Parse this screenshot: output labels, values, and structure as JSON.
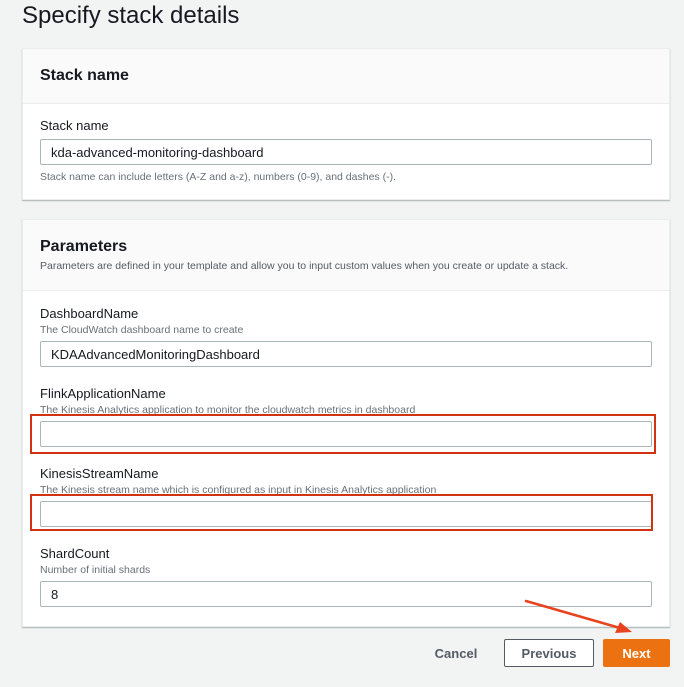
{
  "page": {
    "title": "Specify stack details"
  },
  "stack_name_panel": {
    "title": "Stack name",
    "field_label": "Stack name",
    "field_value": "kda-advanced-monitoring-dashboard",
    "constraint": "Stack name can include letters (A-Z and a-z), numbers (0-9), and dashes (-)."
  },
  "parameters_panel": {
    "title": "Parameters",
    "description": "Parameters are defined in your template and allow you to input custom values when you create or update a stack.",
    "fields": [
      {
        "label": "DashboardName",
        "description": "The CloudWatch dashboard name to create",
        "value": "KDAAdvancedMonitoringDashboard"
      },
      {
        "label": "FlinkApplicationName",
        "description": "The Kinesis Analytics application to monitor the cloudwatch metrics in dashboard",
        "value": ""
      },
      {
        "label": "KinesisStreamName",
        "description": "The Kinesis stream name which is configured as input in Kinesis Analytics application",
        "value": ""
      },
      {
        "label": "ShardCount",
        "description": "Number of initial shards",
        "value": "8"
      }
    ]
  },
  "actions": {
    "cancel": "Cancel",
    "previous": "Previous",
    "next": "Next"
  },
  "colors": {
    "primary": "#ec7211",
    "highlight": "#d13212",
    "arrow": "#e8431f"
  }
}
